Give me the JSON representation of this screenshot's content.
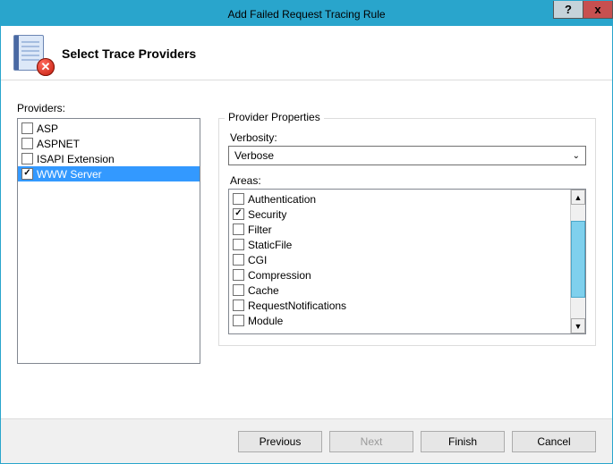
{
  "window": {
    "title": "Add Failed Request Tracing Rule"
  },
  "header": {
    "title": "Select Trace Providers"
  },
  "providers": {
    "label": "Providers:",
    "items": [
      {
        "label": "ASP",
        "checked": false,
        "selected": false
      },
      {
        "label": "ASPNET",
        "checked": false,
        "selected": false
      },
      {
        "label": "ISAPI Extension",
        "checked": false,
        "selected": false
      },
      {
        "label": "WWW Server",
        "checked": true,
        "selected": true
      }
    ]
  },
  "properties": {
    "legend": "Provider Properties",
    "verbosity_label": "Verbosity:",
    "verbosity_value": "Verbose",
    "areas_label": "Areas:",
    "areas": [
      {
        "label": "Authentication",
        "checked": false
      },
      {
        "label": "Security",
        "checked": true
      },
      {
        "label": "Filter",
        "checked": false
      },
      {
        "label": "StaticFile",
        "checked": false
      },
      {
        "label": "CGI",
        "checked": false
      },
      {
        "label": "Compression",
        "checked": false
      },
      {
        "label": "Cache",
        "checked": false
      },
      {
        "label": "RequestNotifications",
        "checked": false
      },
      {
        "label": "Module",
        "checked": false
      }
    ]
  },
  "buttons": {
    "previous": "Previous",
    "next": "Next",
    "finish": "Finish",
    "cancel": "Cancel"
  },
  "titlebar": {
    "help": "?",
    "close": "x"
  }
}
